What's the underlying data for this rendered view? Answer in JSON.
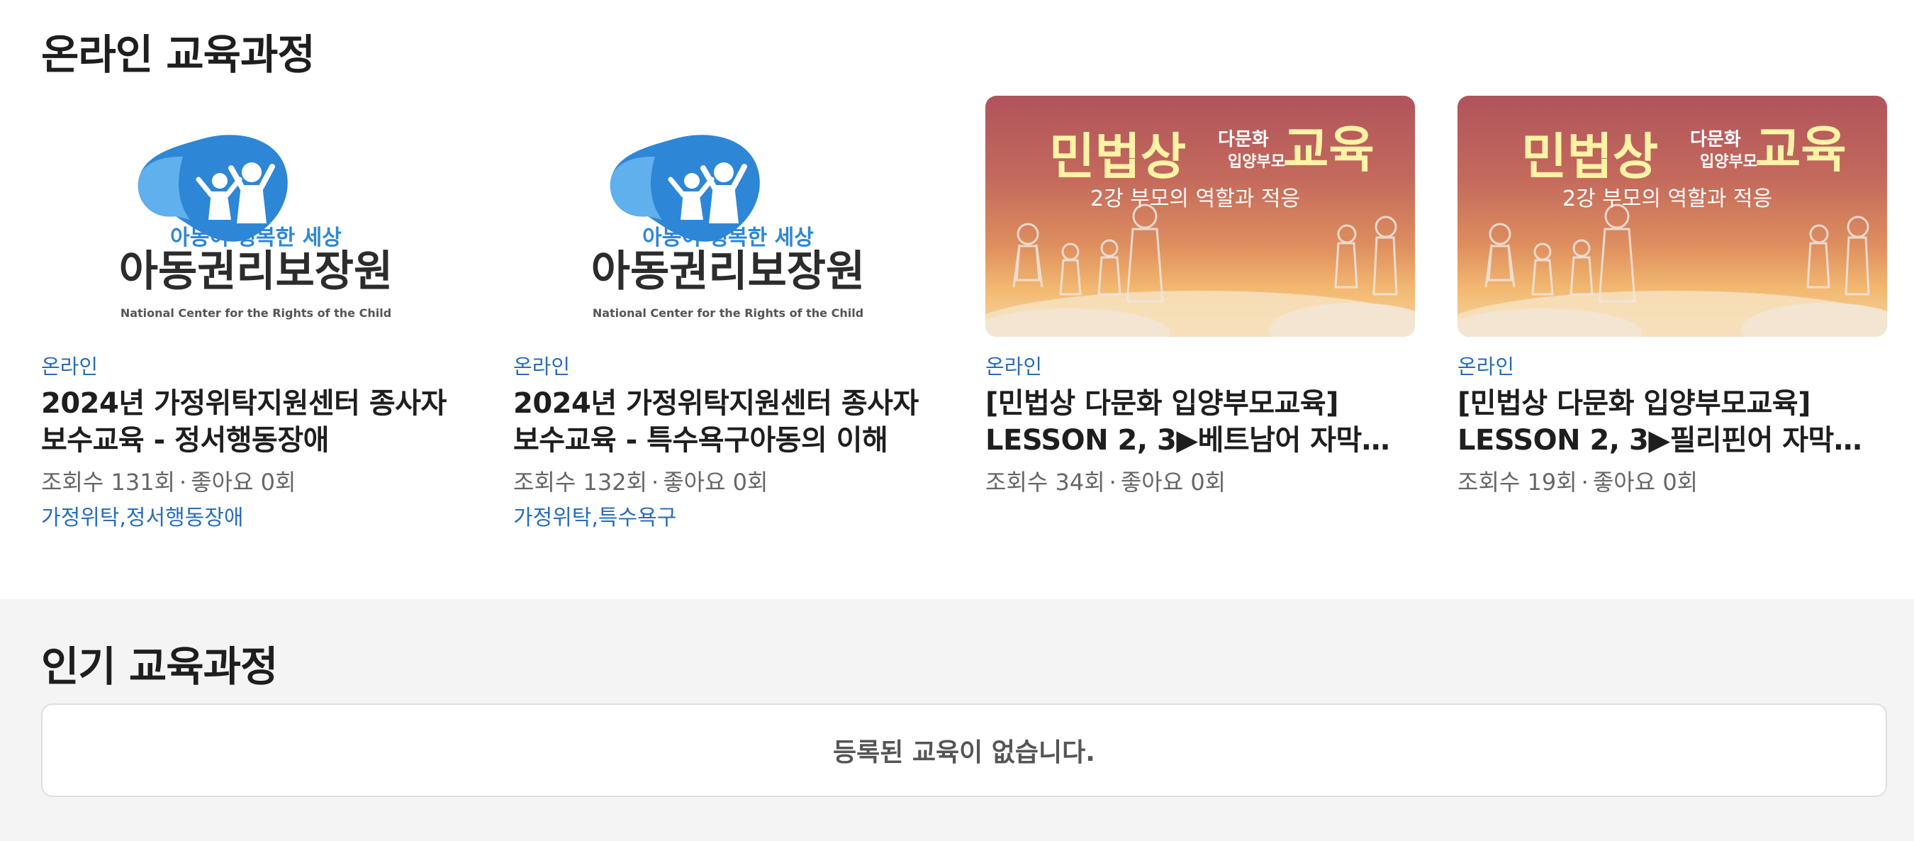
{
  "online": {
    "title": "온라인 교육과정",
    "cards": [
      {
        "type": "온라인",
        "title": "2024년 가정위탁지원센터 종사자 보수교육 - 정서행동장애",
        "views": "조회수 131회",
        "likes": "좋아요 0회",
        "tags": "가정위탁,정서행동장애",
        "thumb": {
          "slogan": "아동이 행복한 세상",
          "name": "아동권리보장원",
          "en": "National Center for the Rights of the Child"
        }
      },
      {
        "type": "온라인",
        "title": "2024년 가정위탁지원센터 종사자 보수교육 - 특수욕구아동의 이해",
        "views": "조회수 132회",
        "likes": "좋아요 0회",
        "tags": "가정위탁,특수욕구",
        "thumb": {
          "slogan": "아동이 행복한 세상",
          "name": "아동권리보장원",
          "en": "National Center for the Rights of the Child"
        }
      },
      {
        "type": "온라인",
        "title": "[민법상 다문화 입양부모교육] LESSON 2, 3▶베트남어 자막…",
        "views": "조회수 34회",
        "likes": "좋아요 0회",
        "tags": "",
        "thumb": {
          "big1": "민법상",
          "small1": "다문화",
          "small2": "입양부모",
          "big2": "교육",
          "sub": "2강 부모의 역할과 적응"
        }
      },
      {
        "type": "온라인",
        "title": "[민법상 다문화 입양부모교육] LESSON 2, 3▶필리핀어 자막…",
        "views": "조회수 19회",
        "likes": "좋아요 0회",
        "tags": "",
        "thumb": {
          "big1": "민법상",
          "small1": "다문화",
          "small2": "입양부모",
          "big2": "교육",
          "sub": "2강 부모의 역할과 적응"
        }
      }
    ]
  },
  "popular": {
    "title": "인기 교육과정",
    "empty_message": "등록된 교육이 없습니다."
  },
  "colors": {
    "accent_blue": "#2a6db8",
    "logo_blue": "#2e86d6",
    "logo_light": "#5fb0ec",
    "sunset_top": "#b0535c",
    "sunset_glow": "#f2b870",
    "headline_yellow": "#fff3a6"
  }
}
